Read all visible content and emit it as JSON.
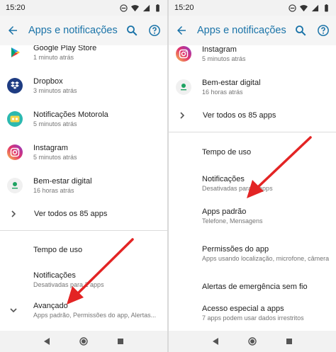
{
  "colors": {
    "accent": "#1a73a8",
    "annotation_arrow": "#e32424"
  },
  "left": {
    "status": {
      "time": "15:20"
    },
    "toolbar": {
      "title": "Apps e notificações"
    },
    "apps": [
      {
        "name": "Google Play Store",
        "time": "1 minuto atrás",
        "icon": "play-store-icon"
      },
      {
        "name": "Dropbox",
        "time": "3 minutos atrás",
        "icon": "dropbox-icon"
      },
      {
        "name": "Notificações Motorola",
        "time": "5 minutos atrás",
        "icon": "motorola-icon"
      },
      {
        "name": "Instagram",
        "time": "5 minutos atrás",
        "icon": "instagram-icon"
      },
      {
        "name": "Bem-estar digital",
        "time": "16 horas atrás",
        "icon": "digital-wellbeing-icon"
      }
    ],
    "see_all": "Ver todos os 85 apps",
    "settings": [
      {
        "title": "Tempo de uso"
      },
      {
        "title": "Notificações",
        "sub": "Desativadas para 2 apps"
      }
    ],
    "advanced": {
      "title": "Avançado",
      "sub": "Apps padrão, Permissões do app, Alertas..."
    }
  },
  "right": {
    "status": {
      "time": "15:20"
    },
    "toolbar": {
      "title": "Apps e notificações"
    },
    "apps": [
      {
        "name": "Instagram",
        "time": "5 minutos atrás",
        "icon": "instagram-icon"
      },
      {
        "name": "Bem-estar digital",
        "time": "16 horas atrás",
        "icon": "digital-wellbeing-icon"
      }
    ],
    "see_all": "Ver todos os 85 apps",
    "settings": [
      {
        "title": "Tempo de uso"
      },
      {
        "title": "Notificações",
        "sub": "Desativadas para 2 apps"
      },
      {
        "title": "Apps padrão",
        "sub": "Telefone, Mensagens"
      },
      {
        "title": "Permissões do app",
        "sub": "Apps usando localização, microfone, câmera"
      },
      {
        "title": "Alertas de emergência sem fio"
      },
      {
        "title": "Acesso especial a apps",
        "sub": "7 apps podem usar dados irrestritos"
      }
    ]
  }
}
